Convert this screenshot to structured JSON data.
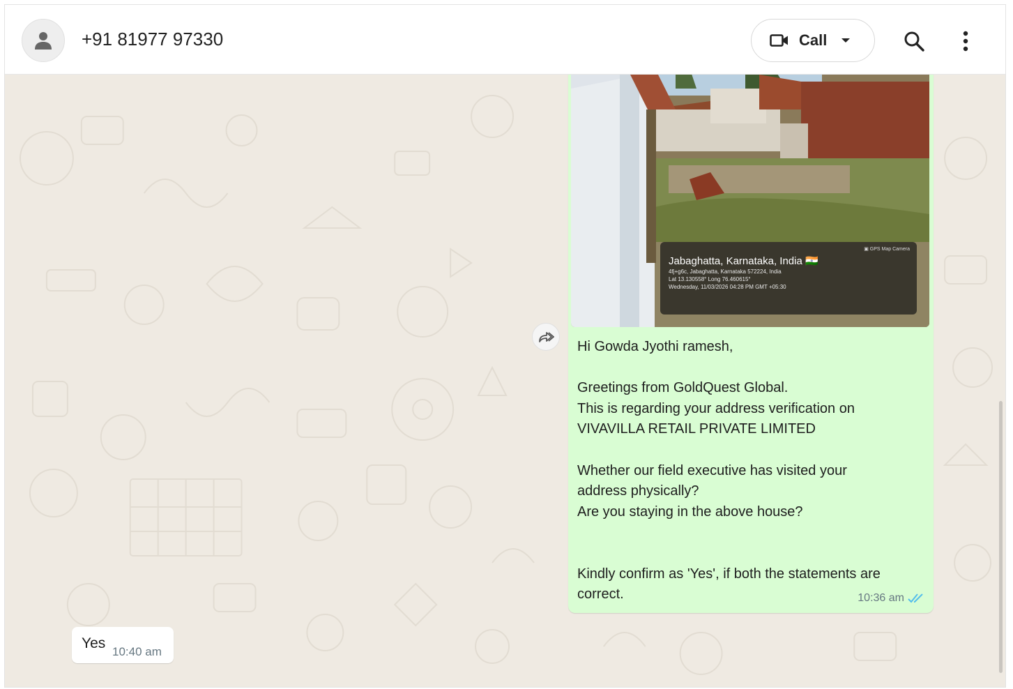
{
  "header": {
    "contact_name": "+91 81977 97330",
    "call_label": "Call",
    "icons": [
      "person-icon",
      "video-camera-icon",
      "dropdown-caret-icon",
      "search-icon",
      "more-vert-icon"
    ]
  },
  "outgoing_message": {
    "photo_overlay": {
      "title": "Jabaghatta, Karnataka, India 🇮🇳",
      "line1": "4fj+g6c, Jabaghatta, Karnataka 572224, India",
      "line2": "Lat 13.130558° Long 76.460615°",
      "line3": "Wednesday, 11/03/2026 04:28 PM GMT +05:30"
    },
    "text": "Hi Gowda Jyothi ramesh,\n\nGreetings from GoldQuest Global.\nThis is regarding your address verification on\nVIVAVILLA RETAIL PRIVATE LIMITED\n\nWhether our field executive has visited your\naddress physically?\nAre you staying in the above house?\n\n\nKindly confirm as 'Yes', if both the statements are\ncorrect.",
    "time": "10:36 am",
    "status_icon": "double-check-read-icon"
  },
  "incoming_message": {
    "text": "Yes",
    "time": "10:40 am"
  },
  "colors": {
    "chat_background": "#efeae2",
    "outgoing_bubble": "#d9fdd3",
    "incoming_bubble": "#ffffff",
    "read_ticks": "#53bdeb"
  }
}
